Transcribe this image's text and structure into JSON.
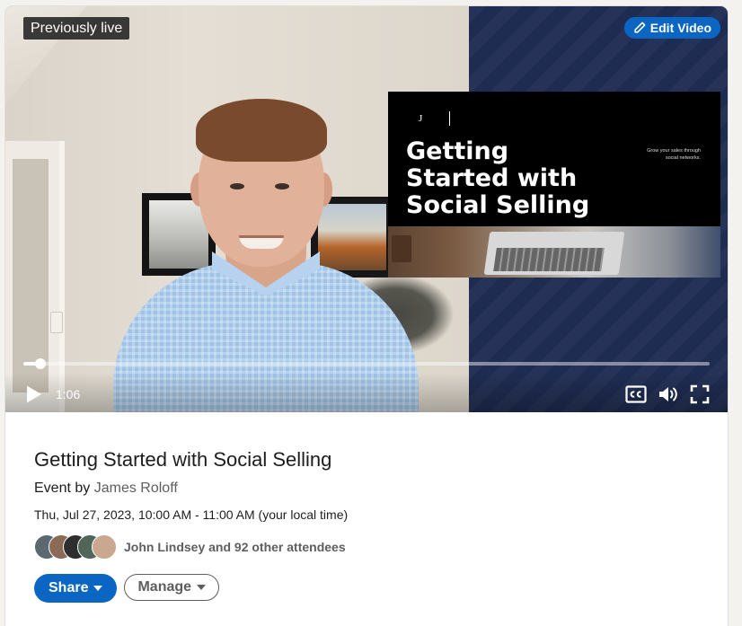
{
  "video": {
    "badge": "Previously live",
    "edit_button": "Edit Video",
    "current_time": "1:06",
    "progress": 0.025,
    "slide": {
      "logo": "J",
      "title_lines": [
        "Getting",
        "Started with",
        "Social Selling"
      ],
      "tagline": "Grow your sales through social networks."
    }
  },
  "event": {
    "title": "Getting Started with Social Selling",
    "by_prefix": "Event by",
    "host": "James Roloff",
    "time": "Thu, Jul 27, 2023, 10:00 AM - 11:00 AM (your local time)",
    "attendees_text": "John Lindsey and 92 other attendees",
    "avatar_colors": [
      "#5a6a70",
      "#8b6b55",
      "#2e2e2e",
      "#4f6659",
      "#c9a88f"
    ]
  },
  "actions": {
    "share_label": "Share",
    "manage_label": "Manage"
  },
  "colors": {
    "accent": "#0a66c2",
    "muted_text": "#5e5e5e",
    "primary_text": "#1d1d1d"
  }
}
